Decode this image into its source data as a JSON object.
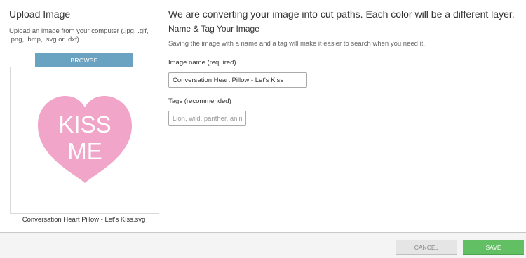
{
  "upload": {
    "title": "Upload Image",
    "description": "Upload an image from your computer (.jpg, .gif, .png, .bmp, .svg or .dxf).",
    "browse_label": "BROWSE",
    "heart_line1": "KISS",
    "heart_line2": "ME",
    "filename": "Conversation Heart Pillow - Let's Kiss.svg"
  },
  "form": {
    "headline": "We are converting your image into cut paths. Each color will be a different layer.",
    "subhead": "Name & Tag Your Image",
    "hint": "Saving the image with a name and a tag will make it easier to search when you need it.",
    "name_label": "Image name (required)",
    "name_value": "Conversation Heart Pillow - Let's Kiss",
    "tags_label": "Tags (recommended)",
    "tags_placeholder": "Lion, wild, panther, animal"
  },
  "footer": {
    "cancel_label": "CANCEL",
    "save_label": "SAVE"
  },
  "colors": {
    "heart": "#f0a5c9",
    "browse": "#6aa2c2",
    "save": "#62bf63",
    "cancel": "#e5e5e5"
  }
}
